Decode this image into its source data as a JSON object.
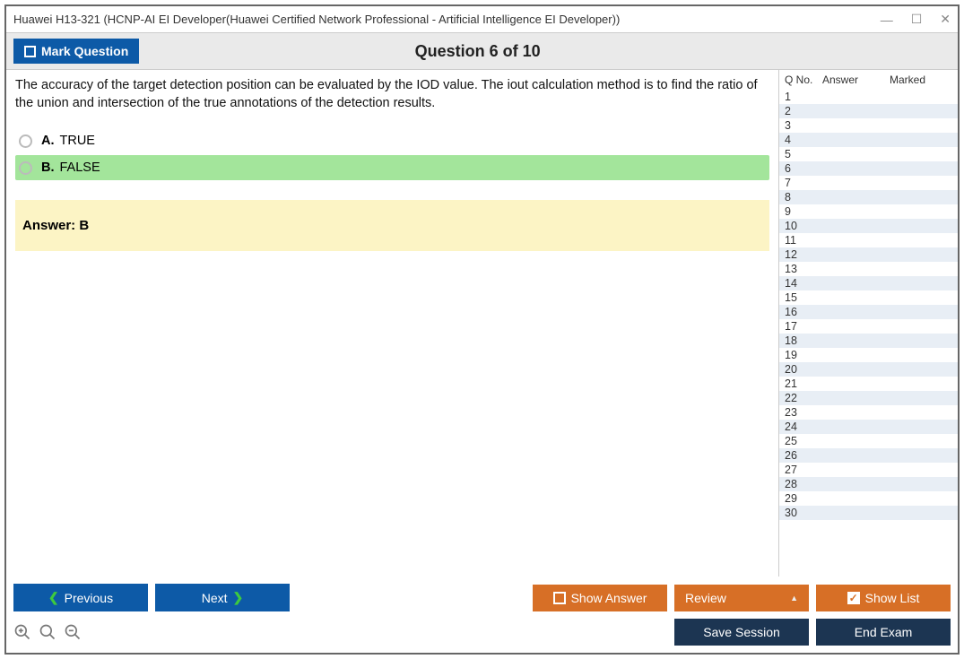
{
  "window": {
    "title": "Huawei H13-321 (HCNP-AI EI Developer(Huawei Certified Network Professional - Artificial Intelligence EI Developer))"
  },
  "header": {
    "mark_label": "Mark Question",
    "question_title": "Question 6 of 10"
  },
  "question": {
    "text": "The accuracy of the target detection position can be evaluated by the IOD value. The iout calculation method is to find the ratio of the union and intersection of the true annotations of the detection results.",
    "options": [
      {
        "letter": "A.",
        "text": "TRUE",
        "correct": false
      },
      {
        "letter": "B.",
        "text": "FALSE",
        "correct": true
      }
    ],
    "answer_label": "Answer: B"
  },
  "sidebar": {
    "headers": {
      "qno": "Q No.",
      "answer": "Answer",
      "marked": "Marked"
    },
    "rows": [
      {
        "n": "1"
      },
      {
        "n": "2"
      },
      {
        "n": "3"
      },
      {
        "n": "4"
      },
      {
        "n": "5"
      },
      {
        "n": "6"
      },
      {
        "n": "7"
      },
      {
        "n": "8"
      },
      {
        "n": "9"
      },
      {
        "n": "10"
      },
      {
        "n": "11"
      },
      {
        "n": "12"
      },
      {
        "n": "13"
      },
      {
        "n": "14"
      },
      {
        "n": "15"
      },
      {
        "n": "16"
      },
      {
        "n": "17"
      },
      {
        "n": "18"
      },
      {
        "n": "19"
      },
      {
        "n": "20"
      },
      {
        "n": "21"
      },
      {
        "n": "22"
      },
      {
        "n": "23"
      },
      {
        "n": "24"
      },
      {
        "n": "25"
      },
      {
        "n": "26"
      },
      {
        "n": "27"
      },
      {
        "n": "28"
      },
      {
        "n": "29"
      },
      {
        "n": "30"
      }
    ]
  },
  "buttons": {
    "previous": "Previous",
    "next": "Next",
    "show_answer": "Show Answer",
    "review": "Review",
    "show_list": "Show List",
    "save_session": "Save Session",
    "end_exam": "End Exam"
  }
}
